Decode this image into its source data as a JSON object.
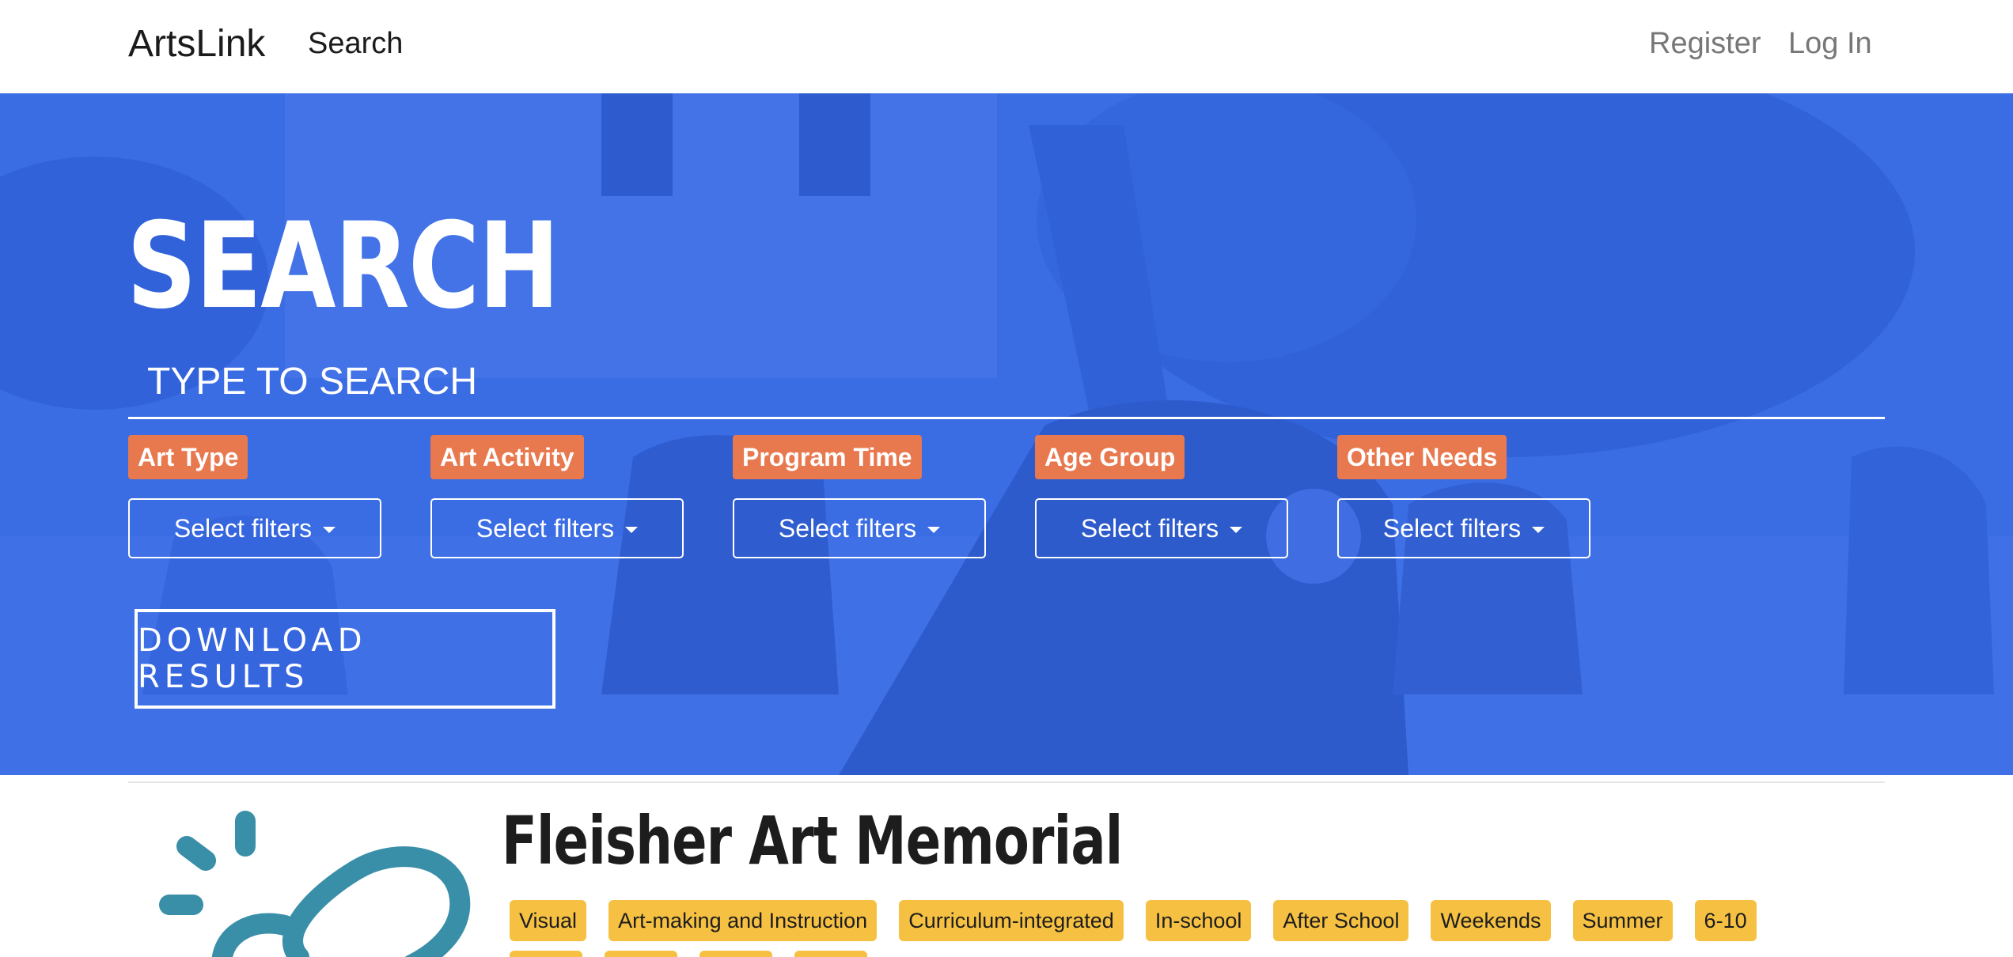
{
  "nav": {
    "brand": "ArtsLink",
    "search": "Search",
    "register": "Register",
    "login": "Log In"
  },
  "hero": {
    "title": "SEARCH",
    "search_placeholder": "TYPE TO SEARCH",
    "filters": [
      {
        "label": "Art Type",
        "button": "Select filters"
      },
      {
        "label": "Art Activity",
        "button": "Select filters"
      },
      {
        "label": "Program Time",
        "button": "Select filters"
      },
      {
        "label": "Age Group",
        "button": "Select filters"
      },
      {
        "label": "Other Needs",
        "button": "Select filters"
      }
    ],
    "download": "DOWNLOAD RESULTS"
  },
  "result": {
    "title": "Fleisher Art Memorial",
    "tags": [
      "Visual",
      "Art-making and Instruction",
      "Curriculum-integrated",
      "In-school",
      "After School",
      "Weekends",
      "Summer",
      "6-10"
    ]
  },
  "colors": {
    "hero_overlay": "#3468e8",
    "filter_label": "#e8784e",
    "tag": "#f6c142",
    "logo": "#3a8fa8"
  }
}
